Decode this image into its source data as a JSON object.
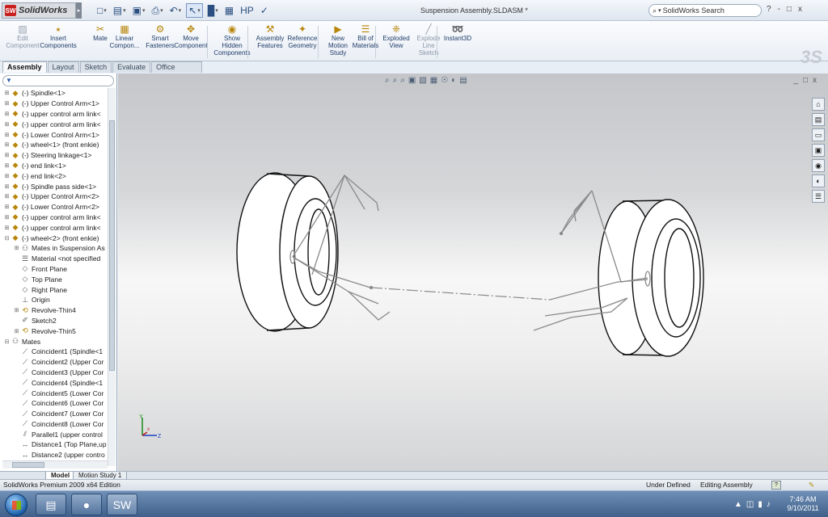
{
  "app": {
    "name": "SolidWorks",
    "logo_mark": "SW",
    "document_title": "Suspension Assembly.SLDASM *"
  },
  "search": {
    "placeholder": "SolidWorks Search"
  },
  "window_controls": [
    "?",
    "-",
    "□",
    "x"
  ],
  "quick_access": [
    {
      "icon": "new-document-icon",
      "glyph": "□"
    },
    {
      "icon": "open-folder-icon",
      "glyph": "▤"
    },
    {
      "icon": "save-icon",
      "glyph": "▣"
    },
    {
      "icon": "print-icon",
      "glyph": "⎙"
    },
    {
      "icon": "undo-icon",
      "glyph": "↶"
    },
    {
      "icon": "select-cursor-icon",
      "glyph": "↖"
    },
    {
      "icon": "rebuild-icon",
      "glyph": "█"
    },
    {
      "icon": "options-icon",
      "glyph": "▦"
    },
    {
      "icon": "hp-icon",
      "glyph": "HP"
    },
    {
      "icon": "toolbox-icon",
      "glyph": "✓"
    }
  ],
  "commands": [
    {
      "label": "Edit Component",
      "icon": "▨",
      "disabled": true
    },
    {
      "label": "Insert Components",
      "icon": "⭑",
      "disabled": false
    },
    {
      "label": "Mate",
      "icon": "✂",
      "disabled": false
    },
    {
      "label": "Linear Compon...",
      "icon": "▦",
      "disabled": false
    },
    {
      "label": "Smart Fasteners",
      "icon": "⚙",
      "disabled": false
    },
    {
      "label": "Move Component",
      "icon": "✥",
      "disabled": false
    },
    {
      "label": "Show Hidden Components",
      "icon": "◉",
      "disabled": false
    },
    {
      "label": "Assembly Features",
      "icon": "⚒",
      "disabled": false
    },
    {
      "label": "Reference Geometry",
      "icon": "✦",
      "disabled": false
    },
    {
      "label": "New Motion Study",
      "icon": "▶",
      "disabled": false
    },
    {
      "label": "Bill of Materials",
      "icon": "☰",
      "disabled": false
    },
    {
      "label": "Exploded View",
      "icon": "❈",
      "disabled": false
    },
    {
      "label": "Explode Line Sketch",
      "icon": "╱",
      "disabled": true
    },
    {
      "label": "Instant3D",
      "icon": "➿",
      "disabled": false
    }
  ],
  "tabs": [
    "Assembly",
    "Layout",
    "Sketch",
    "Evaluate",
    "Office Products"
  ],
  "tree": {
    "filter_icon": "▼",
    "items": [
      {
        "label": "(-) Spindle<1>",
        "type": "part",
        "expand": "+",
        "indent": 0
      },
      {
        "label": "(-) Upper Control Arm<1>",
        "type": "part",
        "expand": "+",
        "indent": 0
      },
      {
        "label": "(-) upper control arm link<",
        "type": "part",
        "expand": "+",
        "indent": 0
      },
      {
        "label": "(-) upper control arm link<",
        "type": "part",
        "expand": "+",
        "indent": 0
      },
      {
        "label": "(-) Lower Control Arm<1>",
        "type": "part",
        "expand": "+",
        "indent": 0
      },
      {
        "label": "(-) wheel<1> (front enkie)",
        "type": "part",
        "expand": "+",
        "indent": 0
      },
      {
        "label": "(-) Steering linkage<1>",
        "type": "part",
        "expand": "+",
        "indent": 0
      },
      {
        "label": "(-) end link<1>",
        "type": "part",
        "expand": "+",
        "indent": 0
      },
      {
        "label": "(-) end link<2>",
        "type": "part",
        "expand": "+",
        "indent": 0
      },
      {
        "label": "(-) Spindle pass side<1>",
        "type": "part",
        "expand": "+",
        "indent": 0
      },
      {
        "label": "(-) Upper Control Arm<2>",
        "type": "part",
        "expand": "+",
        "indent": 0
      },
      {
        "label": "(-) Lower Control Arm<2>",
        "type": "part",
        "expand": "+",
        "indent": 0
      },
      {
        "label": "(-) upper control arm link<",
        "type": "part",
        "expand": "+",
        "indent": 0
      },
      {
        "label": "(-) upper control arm link<",
        "type": "part",
        "expand": "+",
        "indent": 0
      },
      {
        "label": "(-) wheel<2> (front enkie)",
        "type": "part",
        "expand": "-",
        "indent": 0
      },
      {
        "label": "Mates in Suspension As",
        "type": "mate",
        "expand": "+",
        "indent": 1
      },
      {
        "label": "Material <not specified",
        "type": "material",
        "expand": "",
        "indent": 1
      },
      {
        "label": "Front Plane",
        "type": "plane",
        "expand": "",
        "indent": 1
      },
      {
        "label": "Top Plane",
        "type": "plane",
        "expand": "",
        "indent": 1
      },
      {
        "label": "Right Plane",
        "type": "plane",
        "expand": "",
        "indent": 1
      },
      {
        "label": "Origin",
        "type": "origin",
        "expand": "",
        "indent": 1
      },
      {
        "label": "Revolve-Thin4",
        "type": "feature",
        "expand": "+",
        "indent": 1
      },
      {
        "label": "Sketch2",
        "type": "sketch",
        "expand": "",
        "indent": 1
      },
      {
        "label": "Revolve-Thin5",
        "type": "feature",
        "expand": "+",
        "indent": 1
      },
      {
        "label": "Mates",
        "type": "mates",
        "expand": "-",
        "indent": 0
      },
      {
        "label": "Coincident1 (Spindle<1",
        "type": "coincident",
        "expand": "",
        "indent": 1
      },
      {
        "label": "Coincident2 (Upper Cor",
        "type": "coincident",
        "expand": "",
        "indent": 1
      },
      {
        "label": "Coincident3 (Upper Cor",
        "type": "coincident",
        "expand": "",
        "indent": 1
      },
      {
        "label": "Coincident4 (Spindle<1",
        "type": "coincident",
        "expand": "",
        "indent": 1
      },
      {
        "label": "Coincident5 (Lower Cor",
        "type": "coincident",
        "expand": "",
        "indent": 1
      },
      {
        "label": "Coincident6 (Lower Cor",
        "type": "coincident",
        "expand": "",
        "indent": 1
      },
      {
        "label": "Coincident7 (Lower Cor",
        "type": "coincident",
        "expand": "",
        "indent": 1
      },
      {
        "label": "Coincident8 (Lower Cor",
        "type": "coincident",
        "expand": "",
        "indent": 1
      },
      {
        "label": "Parallel1 (upper control",
        "type": "parallel",
        "expand": "",
        "indent": 1
      },
      {
        "label": "Distance1 (Top Plane,up",
        "type": "distance",
        "expand": "",
        "indent": 1
      },
      {
        "label": "Distance2 (upper contro",
        "type": "distance",
        "expand": "",
        "indent": 1
      }
    ]
  },
  "bottom_tabs": [
    "Model",
    "Motion Study 1"
  ],
  "heads_up": [
    "⌕",
    "⌕",
    "⌕",
    "▣",
    "▧",
    "▦",
    "☉",
    "◐",
    "▤"
  ],
  "viewport_ctrls": [
    "_",
    "□",
    "x"
  ],
  "task_pane_icons": [
    "home-icon",
    "library-icon",
    "folder-icon",
    "view-palette-icon",
    "appearance-icon",
    "scene-icon",
    "custom-properties-icon"
  ],
  "triad": {
    "x": "x",
    "y": "Y",
    "z": "Z"
  },
  "status": {
    "edition": "SolidWorks Premium 2009 x64 Edition",
    "state": "Under Defined",
    "mode": "Editing Assembly",
    "help_icon": "?"
  },
  "taskbar": {
    "apps": [
      {
        "name": "file-explorer",
        "glyph": "▤"
      },
      {
        "name": "firefox",
        "glyph": "●"
      },
      {
        "name": "solidworks",
        "glyph": "SW"
      }
    ],
    "time": "7:46 AM",
    "date": "9/10/2011"
  }
}
